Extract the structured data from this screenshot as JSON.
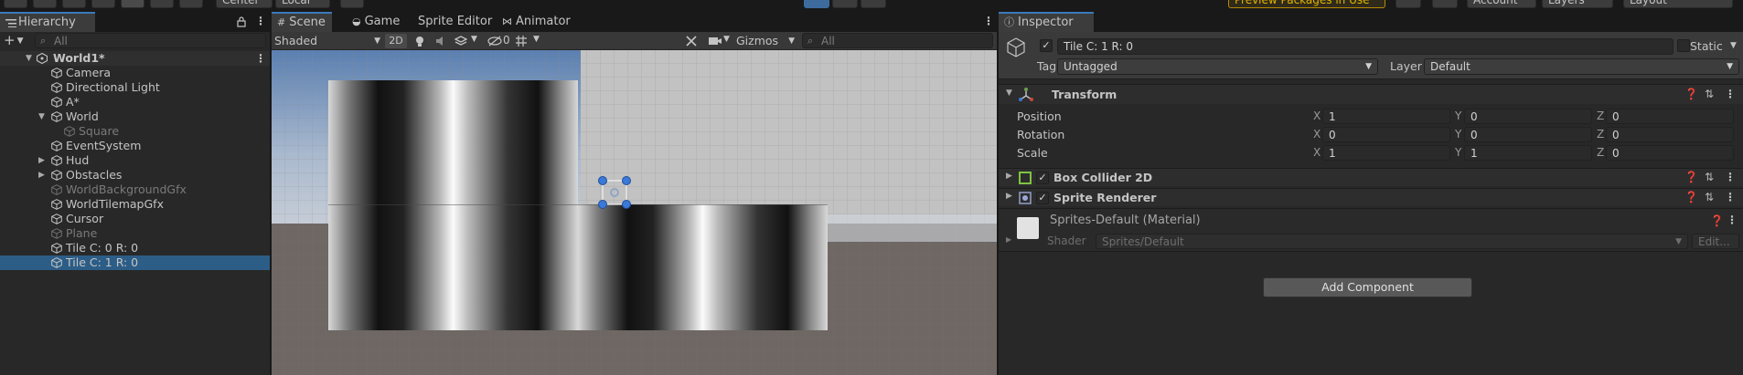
{
  "toolbar": {
    "center_label": "Center",
    "local_label": "Local",
    "preview_packages": "Preview Packages in Use",
    "account": "Account",
    "layers": "Layers",
    "layout": "Layout"
  },
  "hierarchy": {
    "tab": "Hierarchy",
    "add_label": "+",
    "search_placeholder": "All",
    "scene": "World1*",
    "items": [
      {
        "label": "Camera",
        "depth": 1,
        "dim": false,
        "selected": false
      },
      {
        "label": "Directional Light",
        "depth": 1,
        "dim": false,
        "selected": false
      },
      {
        "label": "A*",
        "depth": 1,
        "dim": false,
        "selected": false
      },
      {
        "label": "World",
        "depth": 1,
        "dim": false,
        "selected": false,
        "expanded": true
      },
      {
        "label": "Square",
        "depth": 2,
        "dim": true,
        "selected": false
      },
      {
        "label": "EventSystem",
        "depth": 1,
        "dim": false,
        "selected": false
      },
      {
        "label": "Hud",
        "depth": 1,
        "dim": false,
        "selected": false,
        "collapsed": true
      },
      {
        "label": "Obstacles",
        "depth": 1,
        "dim": false,
        "selected": false,
        "collapsed": true
      },
      {
        "label": "WorldBackgroundGfx",
        "depth": 1,
        "dim": true,
        "selected": false
      },
      {
        "label": "WorldTilemapGfx",
        "depth": 1,
        "dim": false,
        "selected": false
      },
      {
        "label": "Cursor",
        "depth": 1,
        "dim": false,
        "selected": false
      },
      {
        "label": "Plane",
        "depth": 1,
        "dim": true,
        "selected": false
      },
      {
        "label": "Tile C: 0 R: 0",
        "depth": 1,
        "dim": false,
        "selected": false
      },
      {
        "label": "Tile C: 1 R: 0",
        "depth": 1,
        "dim": false,
        "selected": true
      }
    ]
  },
  "scene_view": {
    "tabs": {
      "scene": "Scene",
      "game": "Game",
      "sprite_editor": "Sprite Editor",
      "animator": "Animator"
    },
    "shading_mode": "Shaded",
    "mode_2d": "2D",
    "hidden_count": "0",
    "gizmos": "Gizmos",
    "search_placeholder": "All"
  },
  "inspector": {
    "tab": "Inspector",
    "object_name": "Tile C: 1 R: 0",
    "static_label": "Static",
    "tag_label": "Tag",
    "tag_value": "Untagged",
    "layer_label": "Layer",
    "layer_value": "Default",
    "transform": {
      "title": "Transform",
      "position": {
        "label": "Position",
        "x": "1",
        "y": "0",
        "z": "0"
      },
      "rotation": {
        "label": "Rotation",
        "x": "0",
        "y": "0",
        "z": "0"
      },
      "scale": {
        "label": "Scale",
        "x": "1",
        "y": "1",
        "z": "0"
      }
    },
    "axis": {
      "x": "X",
      "y": "Y",
      "z": "Z"
    },
    "box_collider": "Box Collider 2D",
    "sprite_renderer": "Sprite Renderer",
    "material_name": "Sprites-Default (Material)",
    "shader_label": "Shader",
    "shader_value": "Sprites/Default",
    "edit_label": "Edit...",
    "add_component": "Add Component"
  }
}
